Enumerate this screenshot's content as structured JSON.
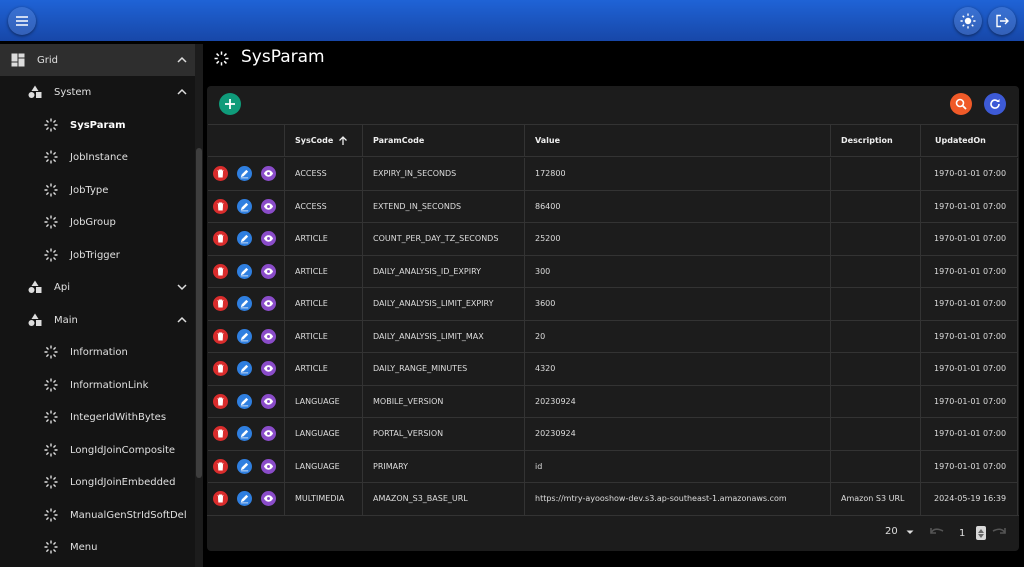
{
  "header": {
    "menu_icon": "menu-icon",
    "theme_icon": "sun-icon",
    "logout_icon": "logout-icon"
  },
  "sidebar": {
    "grid": {
      "label": "Grid",
      "icon": "grid-icon"
    },
    "system": {
      "label": "System",
      "icon": "shapes-icon"
    },
    "system_items": [
      "SysParam",
      "JobInstance",
      "JobType",
      "JobGroup",
      "JobTrigger"
    ],
    "api": {
      "label": "Api",
      "icon": "shapes-icon"
    },
    "main": {
      "label": "Main",
      "icon": "shapes-icon"
    },
    "main_items": [
      "Information",
      "InformationLink",
      "IntegerIdWithBytes",
      "LongIdJoinComposite",
      "LongIdJoinEmbedded",
      "ManualGenStrIdSoftDel",
      "Menu"
    ],
    "active": "SysParam"
  },
  "page": {
    "title": "SysParam"
  },
  "table": {
    "columns": [
      "SysCode",
      "ParamCode",
      "Value",
      "Description",
      "UpdatedOn"
    ],
    "sort": {
      "column": "SysCode",
      "direction": "asc"
    },
    "rows": [
      [
        "ACCESS",
        "EXPIRY_IN_SECONDS",
        "172800",
        "",
        "1970-01-01 07:00"
      ],
      [
        "ACCESS",
        "EXTEND_IN_SECONDS",
        "86400",
        "",
        "1970-01-01 07:00"
      ],
      [
        "ARTICLE",
        "COUNT_PER_DAY_TZ_SECONDS",
        "25200",
        "",
        "1970-01-01 07:00"
      ],
      [
        "ARTICLE",
        "DAILY_ANALYSIS_ID_EXPIRY",
        "300",
        "",
        "1970-01-01 07:00"
      ],
      [
        "ARTICLE",
        "DAILY_ANALYSIS_LIMIT_EXPIRY",
        "3600",
        "",
        "1970-01-01 07:00"
      ],
      [
        "ARTICLE",
        "DAILY_ANALYSIS_LIMIT_MAX",
        "20",
        "",
        "1970-01-01 07:00"
      ],
      [
        "ARTICLE",
        "DAILY_RANGE_MINUTES",
        "4320",
        "",
        "1970-01-01 07:00"
      ],
      [
        "LANGUAGE",
        "MOBILE_VERSION",
        "20230924",
        "",
        "1970-01-01 07:00"
      ],
      [
        "LANGUAGE",
        "PORTAL_VERSION",
        "20230924",
        "",
        "1970-01-01 07:00"
      ],
      [
        "LANGUAGE",
        "PRIMARY",
        "id",
        "",
        "1970-01-01 07:00"
      ],
      [
        "MULTIMEDIA",
        "AMAZON_S3_BASE_URL",
        "https://mtry-ayooshow-dev.s3.ap-southeast-1.amazonaws.com",
        "Amazon S3 URL",
        "2024-05-19 16:39"
      ]
    ],
    "row_actions": [
      "delete-icon",
      "edit-icon",
      "view-icon"
    ]
  },
  "footer": {
    "page_size": "20",
    "page_number": "1"
  },
  "colors": {
    "topbar": "#1f63d6",
    "add": "#0f9b7a",
    "search": "#f05a28",
    "refresh": "#3d5ad6",
    "delete": "#d92c2c",
    "edit": "#2f7fe0",
    "view": "#8a4cc9"
  }
}
